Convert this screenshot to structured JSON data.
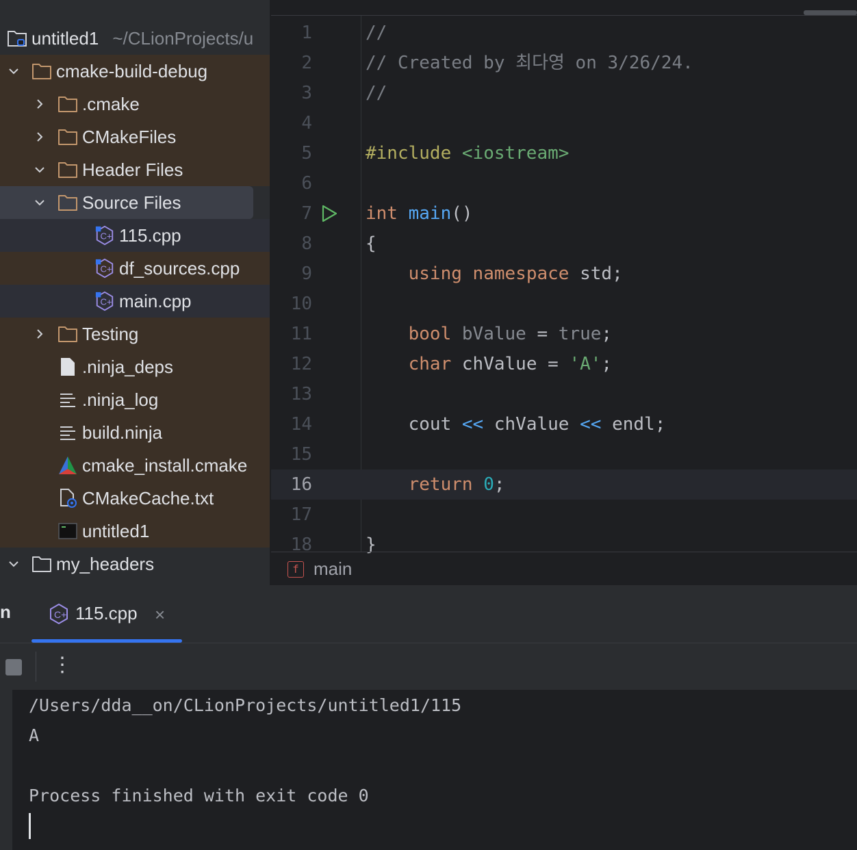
{
  "project": {
    "name": "untitled1",
    "path": "~/CLionProjects/u"
  },
  "tree": [
    {
      "label": "cmake-build-debug",
      "indent": 0,
      "chevron": "down",
      "icon": "folder-icon",
      "style": "brown"
    },
    {
      "label": ".cmake",
      "indent": 1,
      "chevron": "right",
      "icon": "folder-icon",
      "style": "brown"
    },
    {
      "label": "CMakeFiles",
      "indent": 1,
      "chevron": "right",
      "icon": "folder-icon",
      "style": "brown"
    },
    {
      "label": "Header Files",
      "indent": 1,
      "chevron": "down",
      "icon": "folder-icon",
      "style": "brown"
    },
    {
      "label": "Source Files",
      "indent": 1,
      "chevron": "down",
      "icon": "folder-icon",
      "style": "sel"
    },
    {
      "label": "115.cpp",
      "indent": 2,
      "chevron": "",
      "icon": "cpp-file-icon",
      "style": "file-hl"
    },
    {
      "label": "df_sources.cpp",
      "indent": 2,
      "chevron": "",
      "icon": "cpp-file-icon",
      "style": "brown"
    },
    {
      "label": "main.cpp",
      "indent": 2,
      "chevron": "",
      "icon": "cpp-file-icon",
      "style": "file-hl"
    },
    {
      "label": "Testing",
      "indent": 1,
      "chevron": "right",
      "icon": "folder-icon",
      "style": "brown"
    },
    {
      "label": ".ninja_deps",
      "indent": 1,
      "chevron": "",
      "icon": "file-icon",
      "style": "brown"
    },
    {
      "label": ".ninja_log",
      "indent": 1,
      "chevron": "",
      "icon": "text-file-icon",
      "style": "brown"
    },
    {
      "label": "build.ninja",
      "indent": 1,
      "chevron": "",
      "icon": "text-file-icon",
      "style": "brown"
    },
    {
      "label": "cmake_install.cmake",
      "indent": 1,
      "chevron": "",
      "icon": "cmake-icon",
      "style": "brown"
    },
    {
      "label": "CMakeCache.txt",
      "indent": 1,
      "chevron": "",
      "icon": "cache-file-icon",
      "style": "brown"
    },
    {
      "label": "untitled1",
      "indent": 1,
      "chevron": "",
      "icon": "executable-icon",
      "style": "brown"
    },
    {
      "label": "my_headers",
      "indent": 0,
      "chevron": "down",
      "icon": "folder-icon",
      "style": "plain"
    }
  ],
  "editor": {
    "current_line": 16,
    "run_gutter_line": 7,
    "lines": [
      [
        [
          "//",
          "c-comment"
        ]
      ],
      [
        [
          "// Created by 최다영 on 3/26/24.",
          "c-comment"
        ]
      ],
      [
        [
          "//",
          "c-comment"
        ]
      ],
      [],
      [
        [
          "#include ",
          "c-inc"
        ],
        [
          "<iostream>",
          "c-str"
        ]
      ],
      [],
      [
        [
          "int ",
          "c-key"
        ],
        [
          "main",
          "c-fn"
        ],
        [
          "()",
          ""
        ]
      ],
      [
        [
          "{",
          ""
        ]
      ],
      [
        [
          "    ",
          ""
        ],
        [
          "using ",
          "c-key"
        ],
        [
          "namespace ",
          "c-key"
        ],
        [
          "std",
          ""
        ],
        [
          ";",
          ""
        ]
      ],
      [],
      [
        [
          "    ",
          ""
        ],
        [
          "bool ",
          "c-key"
        ],
        [
          "bValue",
          "c-mute"
        ],
        [
          " = ",
          ""
        ],
        [
          "true",
          "c-mute"
        ],
        [
          ";",
          ""
        ]
      ],
      [
        [
          "    ",
          ""
        ],
        [
          "char ",
          "c-key"
        ],
        [
          "chValue",
          ""
        ],
        [
          " = ",
          ""
        ],
        [
          "'A'",
          "c-str"
        ],
        [
          ";",
          ""
        ]
      ],
      [],
      [
        [
          "    ",
          ""
        ],
        [
          "cout ",
          ""
        ],
        [
          "<< ",
          "c-fn"
        ],
        [
          "chValue ",
          ""
        ],
        [
          "<< ",
          "c-fn"
        ],
        [
          "endl",
          ""
        ],
        [
          ";",
          ""
        ]
      ],
      [],
      [
        [
          "    ",
          ""
        ],
        [
          "return ",
          "c-key"
        ],
        [
          "0",
          "c-num"
        ],
        [
          ";",
          ""
        ]
      ],
      [],
      [
        [
          "}",
          ""
        ]
      ]
    ]
  },
  "breadcrumb": {
    "badge": "f",
    "label": "main"
  },
  "run_panel": {
    "partial_tab_label": "n",
    "tab_label": "115.cpp",
    "tab_close": "×",
    "menu_glyph": "⋮",
    "console_lines": [
      "/Users/dda__on/CLionProjects/untitled1/115",
      "A",
      "",
      "Process finished with exit code 0"
    ]
  },
  "colors": {
    "accent": "#3574f0",
    "folder": "#c3976d",
    "run_green": "#5fb865"
  }
}
